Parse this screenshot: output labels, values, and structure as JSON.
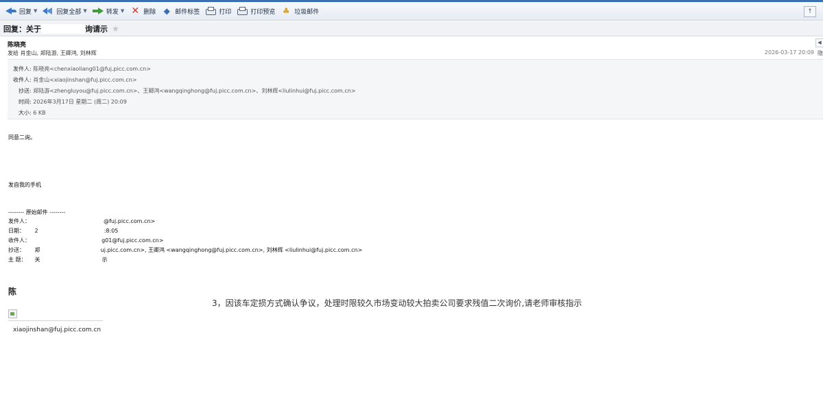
{
  "toolbar": {
    "reply": "回复",
    "reply_all": "回复全部",
    "forward": "转发",
    "delete": "删除",
    "tag": "邮件标签",
    "print": "打印",
    "print_preview": "打印预览",
    "junk": "垃圾邮件"
  },
  "subject": {
    "prefix": "回复：关于",
    "suffix": "询请示"
  },
  "message": {
    "sender": "陈晓亮",
    "recipients_line": "发给 肖金山, 郑陆游, 王卿鸿, 刘林辉",
    "date": "2026-03-17 20:09",
    "date_tail": "隐"
  },
  "header_panel": {
    "from_label": "发件人:",
    "from_value": "陈晓亮<chenxiaoliang01@fuj.picc.com.cn>",
    "to_label": "收件人:",
    "to_value": "肖金山<xiaojinshan@fuj.picc.com.cn>",
    "cc_label": "抄送:",
    "cc_value": "郑陆游<zhengluyou@fuj.picc.com.cn>、王卿鸿<wangqinghong@fuj.picc.com.cn>、刘林辉<liulinhui@fuj.picc.com.cn>",
    "time_label": "时间:",
    "time_value": "2026年3月17日 星期二 (周二) 20:09",
    "size_label": "大小:",
    "size_value": "6 KB"
  },
  "body": {
    "line1": "同意二询。",
    "line2": "发自我的手机",
    "orig_divider": "-------- 原始邮件 --------"
  },
  "original": {
    "from_label": "发件人：",
    "from_tail": "@fuj.picc.com.cn>",
    "date_label": "日期：",
    "date_head": "2",
    "date_tail": ":8:05",
    "to_label": "收件人：",
    "to_tail": "g01@fuj.picc.com.cn>",
    "cc_label": "抄送：",
    "cc_head": "郑",
    "cc_tail": "uj.picc.com.cn>, 王卿鸿 <wangqinghong@fuj.picc.com.cn>, 刘林辉 <liulinhui@fuj.picc.com.cn>",
    "subject_label": "主  题：",
    "subject_head": "关",
    "subject_tail": "示"
  },
  "content": {
    "cursor_char": "陈",
    "main_line": "3，因该车定损方式确认争议，处理时限较久市场变动较大拍卖公司要求残值二次询价,请老师审核指示",
    "sig_email": "xiaojinshan@fuj.picc.com.cn"
  }
}
